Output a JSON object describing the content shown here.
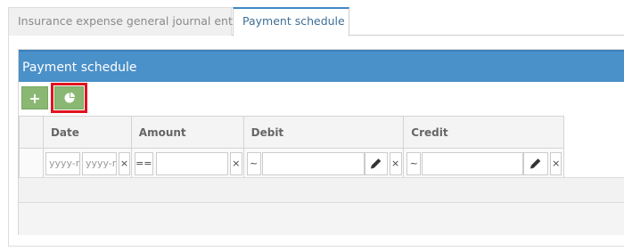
{
  "tabs": [
    {
      "label": "Insurance expense general journal entries",
      "active": false
    },
    {
      "label": "Payment schedule",
      "active": true
    }
  ],
  "panel": {
    "title": "Payment schedule",
    "toolbar": {
      "add_icon": "plus-icon",
      "chart_icon": "pie-chart-icon"
    }
  },
  "grid": {
    "columns": [
      "Date",
      "Amount",
      "Debit",
      "Credit"
    ],
    "filters": {
      "date_from_placeholder": "yyyy-mm-dd",
      "date_to_placeholder": "yyyy-mm-dd",
      "clear": "×",
      "amount_op": "==",
      "debit_op": "~",
      "credit_op": "~"
    }
  },
  "colors": {
    "header_blue": "#4a90c9",
    "button_green": "#8ab873",
    "highlight_red": "#e0141e"
  }
}
